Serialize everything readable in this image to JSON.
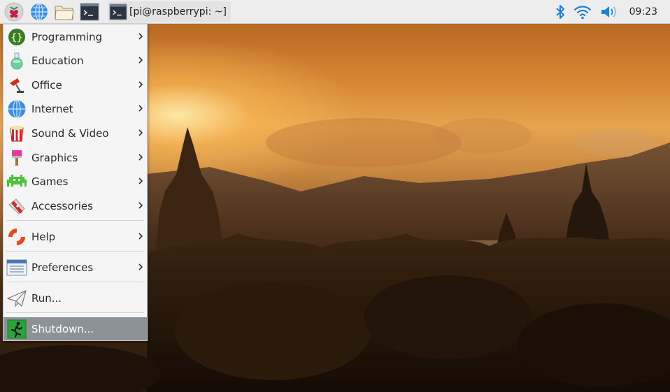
{
  "panel": {
    "launchers": [
      {
        "name": "raspberry-menu-icon"
      },
      {
        "name": "web-browser-icon"
      },
      {
        "name": "file-manager-icon"
      },
      {
        "name": "terminal-icon"
      }
    ],
    "task": {
      "label": "[pi@raspberrypi: ~]",
      "icon": "terminal-icon"
    },
    "tray": {
      "bluetooth": "bluetooth-icon",
      "wifi": "wifi-icon",
      "volume": "volume-icon",
      "clock": "09:23"
    },
    "accent_blue": "#1e7fd6"
  },
  "menu": {
    "items": [
      {
        "label": "Programming",
        "icon": "programming-icon",
        "submenu": true
      },
      {
        "label": "Education",
        "icon": "education-icon",
        "submenu": true
      },
      {
        "label": "Office",
        "icon": "office-icon",
        "submenu": true
      },
      {
        "label": "Internet",
        "icon": "internet-icon",
        "submenu": true
      },
      {
        "label": "Sound & Video",
        "icon": "sound-video-icon",
        "submenu": true
      },
      {
        "label": "Graphics",
        "icon": "graphics-icon",
        "submenu": true
      },
      {
        "label": "Games",
        "icon": "games-icon",
        "submenu": true
      },
      {
        "label": "Accessories",
        "icon": "accessories-icon",
        "submenu": true
      },
      {
        "label": "Help",
        "icon": "help-icon",
        "submenu": true
      },
      {
        "label": "Preferences",
        "icon": "preferences-icon",
        "submenu": true
      },
      {
        "label": "Run...",
        "icon": "run-icon",
        "submenu": false
      },
      {
        "label": "Shutdown...",
        "icon": "shutdown-icon",
        "submenu": false,
        "highlighted": true
      }
    ],
    "highlight_color": "#8d9296"
  }
}
